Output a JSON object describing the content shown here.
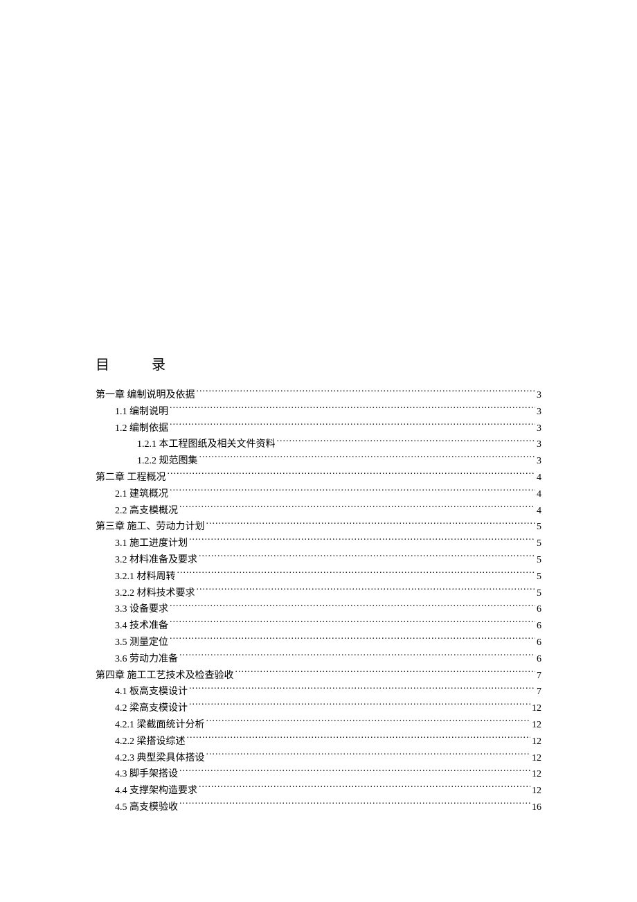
{
  "title": "目 录",
  "toc": [
    {
      "level": 0,
      "text": "第一章  编制说明及依据",
      "page": "3"
    },
    {
      "level": 1,
      "text": "1.1 编制说明",
      "page": "3"
    },
    {
      "level": 1,
      "text": "1.2 编制依据",
      "page": "3"
    },
    {
      "level": 2,
      "text": "1.2.1 本工程图纸及相关文件资料",
      "page": "3"
    },
    {
      "level": 2,
      "text": "1.2.2 规范图集",
      "page": "3"
    },
    {
      "level": 0,
      "text": "第二章 工程概况",
      "page": "4"
    },
    {
      "level": 1,
      "text": "2.1 建筑概况",
      "page": "4"
    },
    {
      "level": 1,
      "text": "2.2 高支模概况",
      "page": "4"
    },
    {
      "level": 0,
      "text": "第三章 施工、劳动力计划",
      "page": "5"
    },
    {
      "level": 1,
      "text": "3.1 施工进度计划",
      "page": "5"
    },
    {
      "level": 1,
      "text": "3.2 材料准备及要求",
      "page": "5"
    },
    {
      "level": 1,
      "text": "3.2.1 材料周转",
      "page": "5"
    },
    {
      "level": 1,
      "text": "3.2.2 材料技术要求",
      "page": "5"
    },
    {
      "level": 1,
      "text": "3.3 设备要求",
      "page": "6"
    },
    {
      "level": 1,
      "text": "3.4 技术准备",
      "page": "6"
    },
    {
      "level": 1,
      "text": "3.5 测量定位",
      "page": "6"
    },
    {
      "level": 1,
      "text": "3.6 劳动力准备",
      "page": "6"
    },
    {
      "level": 0,
      "text": "第四章 施工工艺技术及检查验收",
      "page": "7"
    },
    {
      "level": 1,
      "text": "4.1 板高支模设计",
      "page": "7"
    },
    {
      "level": 1,
      "text": "4.2 梁高支模设计",
      "page": "12"
    },
    {
      "level": 1,
      "text": "4.2.1 梁截面统计分析",
      "page": "12"
    },
    {
      "level": 1,
      "text": "4.2.2 梁搭设综述",
      "page": "12"
    },
    {
      "level": 1,
      "text": "4.2.3 典型梁具体搭设",
      "page": "12"
    },
    {
      "level": 1,
      "text": "4.3 脚手架搭设",
      "page": "12"
    },
    {
      "level": 1,
      "text": "4.4 支撑架构造要求",
      "page": "12"
    },
    {
      "level": 1,
      "text": "4.5 高支模验收",
      "page": "16"
    }
  ]
}
